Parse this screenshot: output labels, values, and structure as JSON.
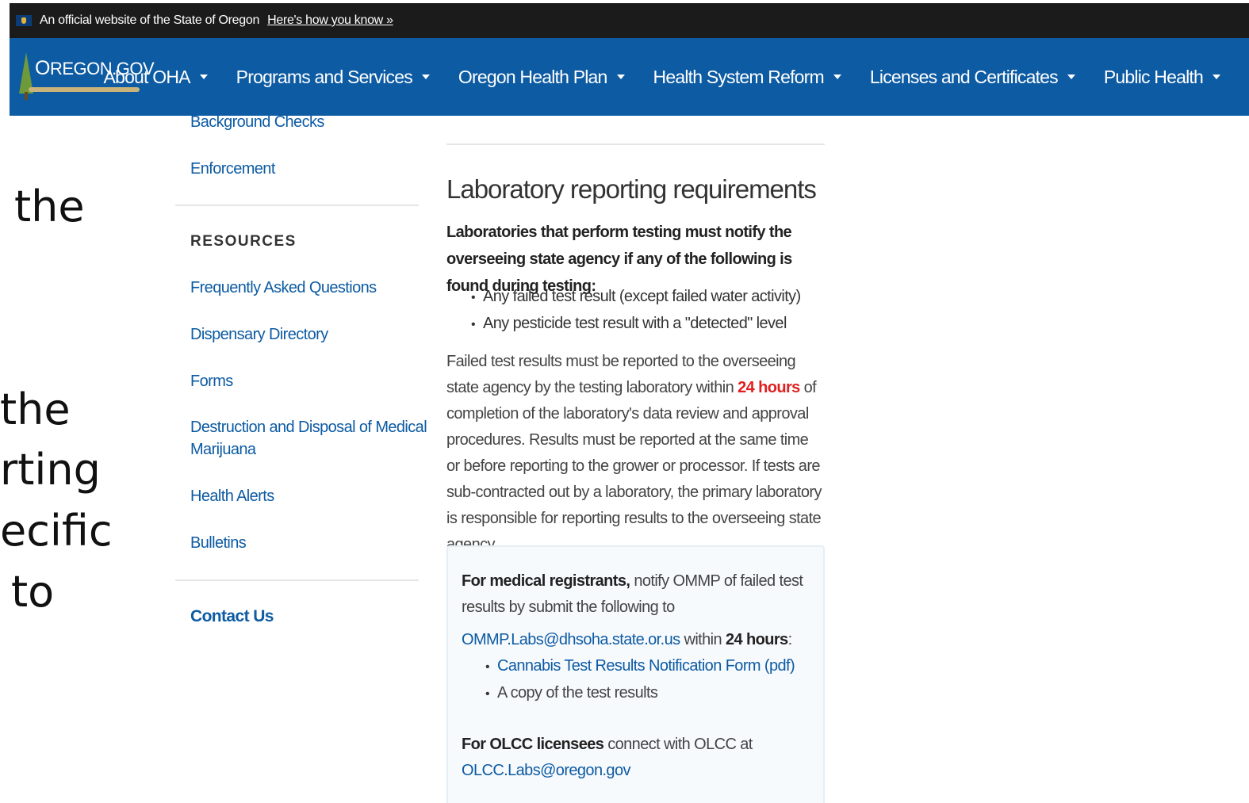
{
  "slide_fragments": [
    "the",
    "the",
    "rting",
    "ecific",
    "to"
  ],
  "banner": {
    "text": "An official website of the State of Oregon",
    "link": "Here's how you know »"
  },
  "nav": {
    "logo_prefix": "O",
    "logo_text": "REGON.GOV",
    "items": [
      {
        "label": "About OHA"
      },
      {
        "label": "Programs and Services"
      },
      {
        "label": "Oregon Health Plan"
      },
      {
        "label": "Health System Reform"
      },
      {
        "label": "Licenses and Certificates"
      },
      {
        "label": "Public Health"
      }
    ]
  },
  "sidebar": {
    "top_links": [
      "Background Checks",
      "Enforcement"
    ],
    "resources_heading": "RESOURCES",
    "resources": [
      "Frequently Asked Questions",
      "Dispensary Directory",
      "Forms",
      "Destruction and Disposal of Medical",
      "Marijuana",
      "Health Alerts",
      "Bulletins"
    ],
    "contact": "Contact Us"
  },
  "main": {
    "title": "Laboratory reporting requirements",
    "lead": "Laboratories that perform testing must notify the overseeing state agency if any of the following is found during testing:",
    "bullets": [
      "Any failed test result (except failed water activity)",
      "Any pesticide test result with a \"detected\" level"
    ],
    "para_before": "Failed test results must be reported to the overseeing state agency by the testing laboratory within",
    "para_highlight": "24 hours",
    "para_after": "of completion of the laboratory's data review and approval procedures. Results must be reported at the same time or before reporting to the grower or processor. If tests are sub-contracted out by a laboratory, the primary laboratory is responsible for reporting results to the overseeing state agency.",
    "callout": {
      "medical_bold": "For medical registrants,",
      "medical_text": "notify OMMP of failed test results by submit the following to",
      "ommp_email": "OMMP.Labs@dhsoha.state.or.us",
      "within": "within",
      "hours": "24 hours",
      "colon": ":",
      "items": [
        "Cannabis Test Results Notification Form (pdf)",
        "A copy of the test results"
      ],
      "olcc_bold": "For OLCC licensees",
      "olcc_text": "connect with OLCC at",
      "olcc_email": "OLCC.Labs@oregon.gov"
    }
  }
}
